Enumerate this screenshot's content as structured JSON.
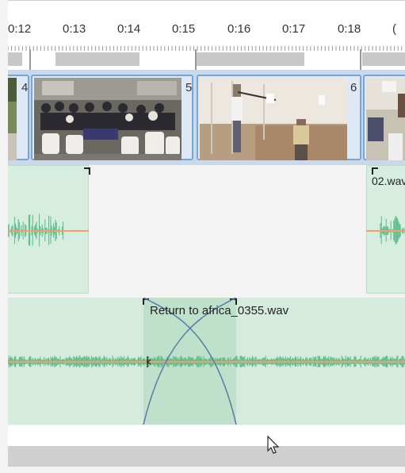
{
  "ruler": {
    "ticks": [
      "0:12",
      "0:13",
      "0:14",
      "0:15",
      "0:16",
      "0:17",
      "0:18"
    ]
  },
  "video_track": {
    "clips": [
      {
        "number": "4"
      },
      {
        "number": "5"
      },
      {
        "number": "6"
      }
    ]
  },
  "audio_track_1": {
    "clips": [
      {
        "name": ""
      },
      {
        "name": "02.wav"
      }
    ]
  },
  "audio_track_2": {
    "clip_name": "Return to africa_0355.wav"
  },
  "colors": {
    "waveform": "#55b884",
    "volume_line": "#f0a070",
    "fade_curve": "#5b78a8",
    "audio_clip_bg": "#d6ede0",
    "video_frame": "#7aa5d3"
  }
}
